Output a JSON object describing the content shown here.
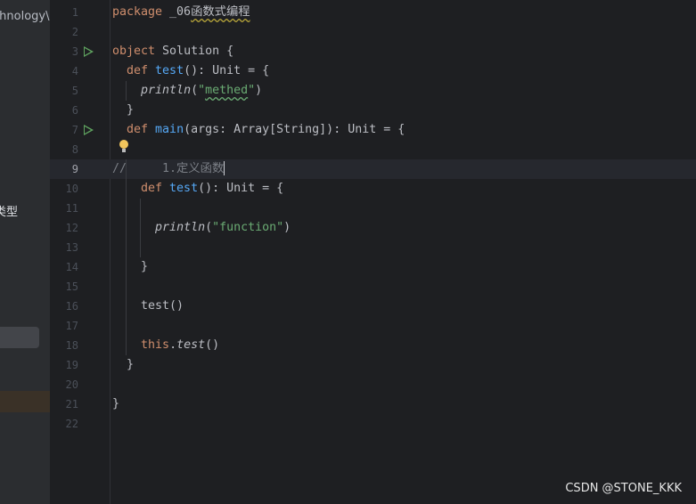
{
  "sidebar": {
    "project_text": "chnology\\",
    "item_text": "类型"
  },
  "editor": {
    "current_line": 9,
    "run_lines": [
      3,
      7
    ],
    "lines": [
      [
        {
          "t": "package ",
          "c": "kw"
        },
        {
          "t": "_06"
        },
        {
          "t": "函数式编程",
          "c": "wavy"
        }
      ],
      [],
      [
        {
          "t": "object ",
          "c": "kw"
        },
        {
          "t": "Solution {"
        }
      ],
      [
        {
          "t": "  def ",
          "c": "kw"
        },
        {
          "t": "test",
          "c": "fn"
        },
        {
          "t": "(): Unit = {"
        }
      ],
      [
        {
          "t": "    "
        },
        {
          "t": "println",
          "c": "it"
        },
        {
          "t": "(",
          "c": ""
        },
        {
          "t": "\"",
          "c": "str"
        },
        {
          "t": "methed",
          "c": "str wavyg"
        },
        {
          "t": "\"",
          "c": "str"
        },
        {
          "t": ")"
        }
      ],
      [
        {
          "t": "  }"
        }
      ],
      [
        {
          "t": "  def ",
          "c": "kw"
        },
        {
          "t": "main",
          "c": "fn"
        },
        {
          "t": "(args: Array[String]): Unit = {"
        }
      ],
      [],
      [
        {
          "t": "//     1.定义函数",
          "c": "cm"
        }
      ],
      [
        {
          "t": "    def ",
          "c": "kw"
        },
        {
          "t": "test",
          "c": "fn"
        },
        {
          "t": "(): Unit = {"
        }
      ],
      [],
      [
        {
          "t": "      "
        },
        {
          "t": "println",
          "c": "it"
        },
        {
          "t": "("
        },
        {
          "t": "\"function\"",
          "c": "str"
        },
        {
          "t": ")"
        }
      ],
      [],
      [
        {
          "t": "    }"
        }
      ],
      [],
      [
        {
          "t": "    test()"
        }
      ],
      [],
      [
        {
          "t": "    "
        },
        {
          "t": "this",
          "c": "kw"
        },
        {
          "t": "."
        },
        {
          "t": "test",
          "c": "it"
        },
        {
          "t": "()"
        }
      ],
      [
        {
          "t": "  }"
        }
      ],
      [],
      [
        {
          "t": "}"
        }
      ],
      []
    ]
  },
  "watermark": "CSDN @STONE_KKK"
}
